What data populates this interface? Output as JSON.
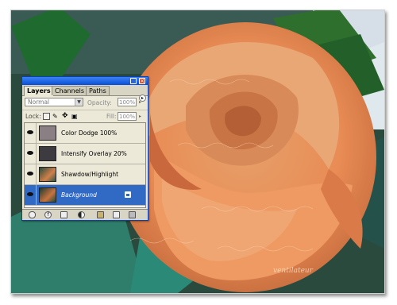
{
  "colors": {
    "panel_bg": "#ece9d8",
    "titlebar": "#0a4ed6",
    "selection": "#316ac5"
  },
  "layers_panel": {
    "tabs": [
      {
        "label": "Layers",
        "active": true
      },
      {
        "label": "Channels",
        "active": false
      },
      {
        "label": "Paths",
        "active": false
      }
    ],
    "blend_mode": "Normal",
    "opacity_label": "Opacity:",
    "opacity_value": "100%",
    "lock_label": "Lock:",
    "fill_label": "Fill:",
    "fill_value": "100%",
    "layers": [
      {
        "name": "Color Dodge 100%",
        "visible": true,
        "selected": false
      },
      {
        "name": "Intensify Overlay 20%",
        "visible": true,
        "selected": false
      },
      {
        "name": "Shawdow/Highlight",
        "visible": true,
        "selected": false
      },
      {
        "name": "Background",
        "visible": true,
        "selected": true,
        "locked": true
      }
    ],
    "bottom_icons": [
      "link-icon",
      "layer-style-icon",
      "mask-icon",
      "adjustment-icon",
      "group-folder-icon",
      "new-layer-icon",
      "trash-icon"
    ]
  },
  "photo": {
    "subject_icon": "rose-photo",
    "overlay_script_text": "ventilateur"
  }
}
